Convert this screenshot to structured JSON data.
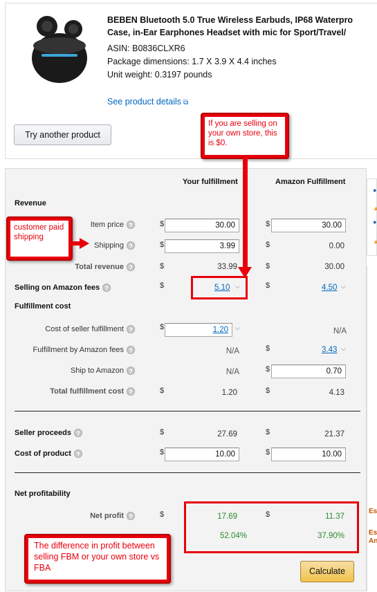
{
  "product": {
    "title_line1": "BEBEN Bluetooth 5.0 True Wireless Earbuds, IP68 Waterpro",
    "title_line2": "Case, in-Ear Earphones Headset with mic for Sport/Travel/",
    "asin": "ASIN: B0836CLXR6",
    "dimensions": "Package dimensions: 1.7 X 3.9 X 4.4 inches",
    "weight": "Unit weight: 0.3197 pounds",
    "details_link": "See product details",
    "try_button": "Try another product"
  },
  "columns": {
    "yours": "Your fulfillment",
    "amazon": "Amazon Fulfillment"
  },
  "sections": {
    "revenue": "Revenue",
    "selling_fees": "Selling on Amazon fees",
    "fulfillment_cost": "Fulfillment cost",
    "seller_proceeds": "Seller proceeds",
    "cost_of_product": "Cost of product",
    "net_profitability": "Net profitability"
  },
  "currency": "$",
  "rows": {
    "item_price": {
      "label": "Item price",
      "yours": "30.00",
      "amazon": "30.00"
    },
    "shipping": {
      "label": "Shipping",
      "yours": "3.99",
      "amazon": "0.00"
    },
    "total_revenue": {
      "label": "Total revenue",
      "yours": "33.99",
      "amazon": "30.00"
    },
    "selling_fees": {
      "yours": "5.10",
      "amazon": "4.50"
    },
    "cost_seller_fulfillment": {
      "label": "Cost of seller fulfillment",
      "yours": "1.20",
      "amazon": "N/A"
    },
    "fba_fees": {
      "label": "Fulfillment by Amazon fees",
      "yours": "N/A",
      "amazon": "3.43"
    },
    "ship_to_amazon": {
      "label": "Ship to Amazon",
      "yours": "N/A",
      "amazon": "0.70"
    },
    "total_fulfillment": {
      "label": "Total fulfillment cost",
      "yours": "1.20",
      "amazon": "4.13"
    },
    "seller_proceeds": {
      "yours": "27.69",
      "amazon": "21.37"
    },
    "cost_of_product": {
      "yours": "10.00",
      "amazon": "10.00"
    },
    "net_profit": {
      "label": "Net profit",
      "yours": "17.69",
      "amazon": "11.37"
    },
    "net_margin": {
      "yours": "52.04%",
      "amazon": "37.90%"
    }
  },
  "side": {
    "es1": "Es",
    "es2": "Es",
    "es3": "An"
  },
  "calculate_button": "Calculate",
  "annotations": {
    "own_store": "If you are selling on your own store, this is $0.",
    "customer_paid": "customer paid shipping",
    "difference": "The difference in profit between selling FBM or your own store vs FBA"
  },
  "colors": {
    "annotation_red": "#e8000b",
    "profit_green": "#2a8a2a",
    "link_blue": "#0066c0"
  }
}
